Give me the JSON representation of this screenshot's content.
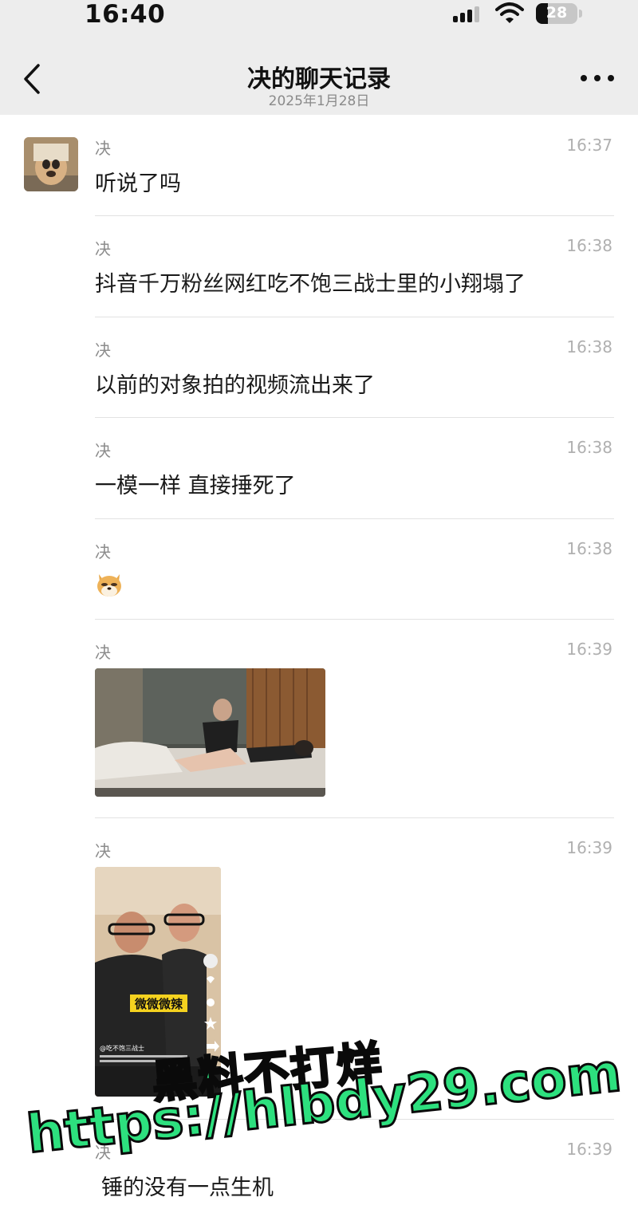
{
  "status_bar": {
    "time": "16:40",
    "battery": "28"
  },
  "header": {
    "title": "决的聊天记录",
    "subtitle": "2025年1月28日",
    "back_icon": "chevron-left-icon",
    "more_icon": "more-dots-icon"
  },
  "messages": [
    {
      "sender": "决",
      "time": "16:37",
      "text": "听说了吗"
    },
    {
      "sender": "决",
      "time": "16:38",
      "text": "抖音千万粉丝网红吃不饱三战士里的小翔塌了"
    },
    {
      "sender": "决",
      "time": "16:38",
      "text": "以前的对象拍的视频流出来了"
    },
    {
      "sender": "决",
      "time": "16:38",
      "text": "一模一样 直接捶死了"
    },
    {
      "sender": "决",
      "time": "16:38",
      "sticker": "doge-emoji"
    },
    {
      "sender": "决",
      "time": "16:39",
      "image": "bedroom-photo"
    },
    {
      "sender": "决",
      "time": "16:39",
      "image": "video-screenshot",
      "video_caption": "微微微辣",
      "video_handle": "@吃不饱三战士"
    },
    {
      "sender": "决",
      "time": "16:39",
      "text": "锤的没有一点生机"
    }
  ],
  "watermark": {
    "line1": "黑料不打烊",
    "line2": "https://hlbdy29.com"
  }
}
